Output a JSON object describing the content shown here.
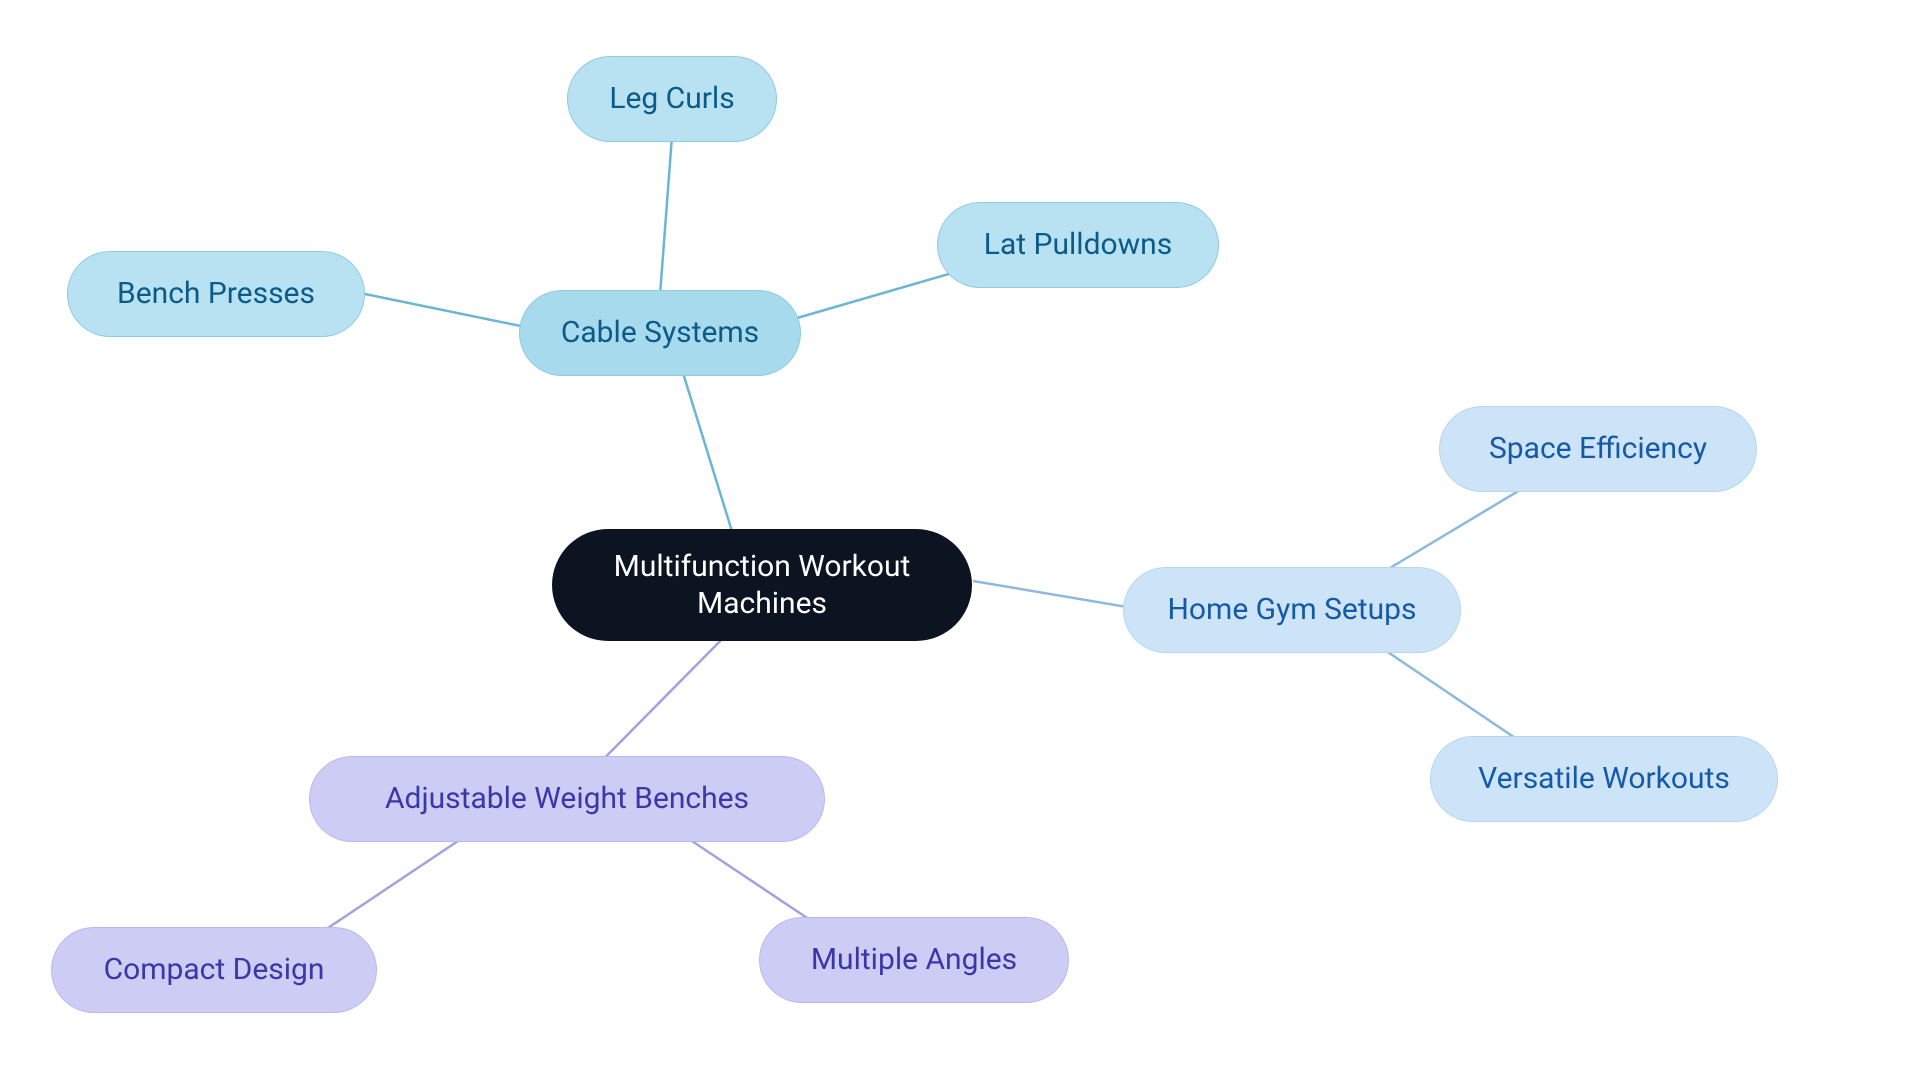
{
  "root": {
    "label": "Multifunction Workout\nMachines"
  },
  "branches": {
    "cable_systems": {
      "label": "Cable Systems",
      "children": {
        "bench_presses": "Bench Presses",
        "leg_curls": "Leg Curls",
        "lat_pulldowns": "Lat Pulldowns"
      }
    },
    "home_gym": {
      "label": "Home Gym Setups",
      "children": {
        "space_efficiency": "Space Efficiency",
        "versatile_workouts": "Versatile Workouts"
      }
    },
    "adj_benches": {
      "label": "Adjustable Weight Benches",
      "children": {
        "compact_design": "Compact Design",
        "multiple_angles": "Multiple Angles"
      }
    }
  }
}
